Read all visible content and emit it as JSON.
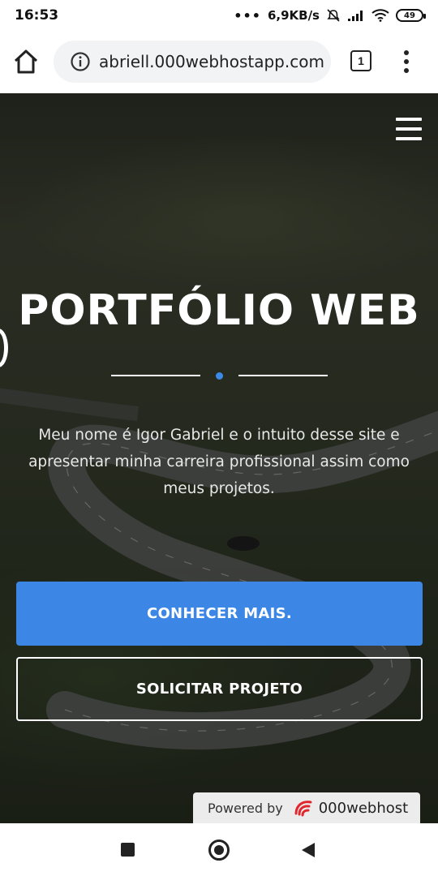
{
  "status_bar": {
    "time": "16:53",
    "dots": "•••",
    "network_speed": "6,9KB/s",
    "battery_level": "49",
    "icons": [
      "alarm-off-icon",
      "signal-icon",
      "wifi-icon",
      "battery-icon"
    ]
  },
  "browser": {
    "url": "abriell.000webhostapp.com",
    "tab_count": "1",
    "icons": [
      "home-icon",
      "info-icon",
      "tabs-icon",
      "more-vert-icon"
    ]
  },
  "hero": {
    "title": "PORTFÓLIO WEB",
    "description": "Meu nome é Igor Gabriel e o intuito desse site e apresentar minha carreira profissional assim como meus projetos.",
    "primary_button": "CONHECER MAIS.",
    "secondary_button": "SOLICITAR PROJETO",
    "accent_color": "#3c87e6"
  },
  "powered_badge": {
    "label": "Powered by",
    "brand": "000webhost"
  },
  "navbar": {
    "icons": [
      "recents-icon",
      "home-circle-icon",
      "back-icon"
    ]
  }
}
